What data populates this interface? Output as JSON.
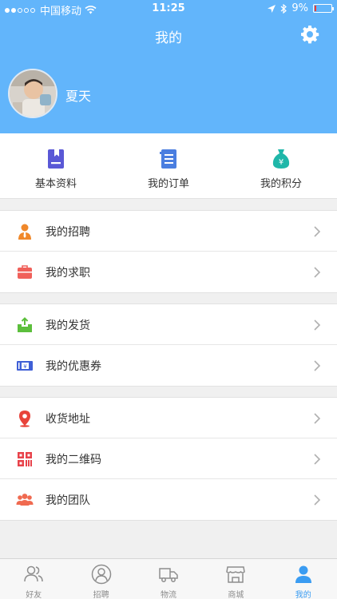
{
  "status_bar": {
    "carrier": "中国移动",
    "time": "11:25",
    "battery": "9%",
    "battery_level": 0.09
  },
  "nav": {
    "title": "我的",
    "settings_icon": "gear-icon"
  },
  "profile": {
    "username": "夏天"
  },
  "quick_links": [
    {
      "label": "基本资料",
      "icon": "profile-bookmark-icon",
      "color": "#5a58d6"
    },
    {
      "label": "我的订单",
      "icon": "order-document-icon",
      "color": "#4a7ee0"
    },
    {
      "label": "我的积分",
      "icon": "money-bag-icon",
      "color": "#1fb7a9"
    }
  ],
  "groups": [
    {
      "items": [
        {
          "label": "我的招聘",
          "icon": "recruiter-icon",
          "color": "#f0882a"
        },
        {
          "label": "我的求职",
          "icon": "briefcase-icon",
          "color": "#f0605a"
        }
      ]
    },
    {
      "items": [
        {
          "label": "我的发货",
          "icon": "shipping-tray-icon",
          "color": "#5cbf3c"
        },
        {
          "label": "我的优惠券",
          "icon": "coupon-icon",
          "color": "#3f5fd6"
        }
      ]
    },
    {
      "items": [
        {
          "label": "收货地址",
          "icon": "location-pin-icon",
          "color": "#e8433a"
        },
        {
          "label": "我的二维码",
          "icon": "qr-code-icon",
          "color": "#e8434b"
        },
        {
          "label": "我的团队",
          "icon": "team-icon",
          "color": "#f06a50"
        }
      ]
    }
  ],
  "tabbar": [
    {
      "label": "好友",
      "icon": "friends-icon"
    },
    {
      "label": "招聘",
      "icon": "recruit-person-icon"
    },
    {
      "label": "物流",
      "icon": "truck-icon"
    },
    {
      "label": "商城",
      "icon": "store-icon"
    },
    {
      "label": "我的",
      "icon": "me-person-icon",
      "active": true
    }
  ],
  "colors": {
    "primary": "#62b5fb",
    "tab_active": "#3a9cf2",
    "tab_inactive": "#8e8e8e"
  }
}
